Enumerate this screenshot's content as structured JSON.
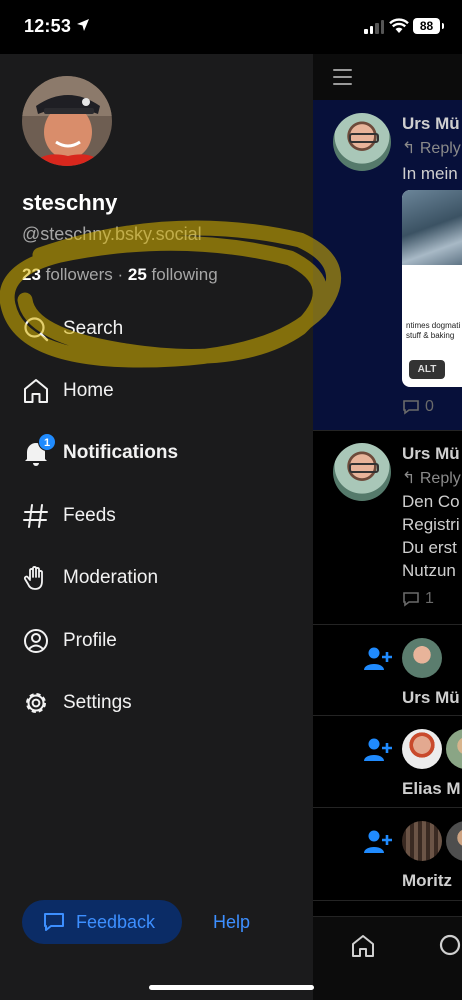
{
  "status_bar": {
    "time": "12:53",
    "battery": "88"
  },
  "drawer": {
    "display_name": "steschny",
    "handle": "@steschny.bsky.social",
    "followers_count": "23",
    "followers_label": "followers",
    "separator": "·",
    "following_count": "25",
    "following_label": "following",
    "nav": [
      {
        "label": "Search",
        "icon": "search-icon"
      },
      {
        "label": "Home",
        "icon": "home-icon"
      },
      {
        "label": "Notifications",
        "icon": "bell-icon",
        "badge": "1"
      },
      {
        "label": "Feeds",
        "icon": "hash-icon"
      },
      {
        "label": "Moderation",
        "icon": "hand-icon"
      },
      {
        "label": "Profile",
        "icon": "user-circle-icon"
      },
      {
        "label": "Settings",
        "icon": "gear-icon"
      }
    ],
    "feedback_label": "Feedback",
    "help_label": "Help"
  },
  "feed": {
    "posts": [
      {
        "author": "Urs Mü",
        "reply": "Reply",
        "text": [
          "In mein"
        ],
        "image_text": [
          "ntimes dogmati",
          "stuff & baking"
        ],
        "alt": "ALT",
        "count": "0"
      },
      {
        "author": "Urs Mü",
        "reply": "Reply",
        "text": [
          "Den Co",
          "Registri",
          "Du erst",
          "Nutzun"
        ],
        "count": "1"
      }
    ],
    "notifications": [
      {
        "name": "Urs Mü"
      },
      {
        "name": "Elias M"
      },
      {
        "name": "Moritz"
      }
    ]
  },
  "colors": {
    "accent": "#208bfe",
    "link": "#3d8fff",
    "drawer_bg": "#1b1b1c",
    "highlight": "#e6c21a"
  }
}
